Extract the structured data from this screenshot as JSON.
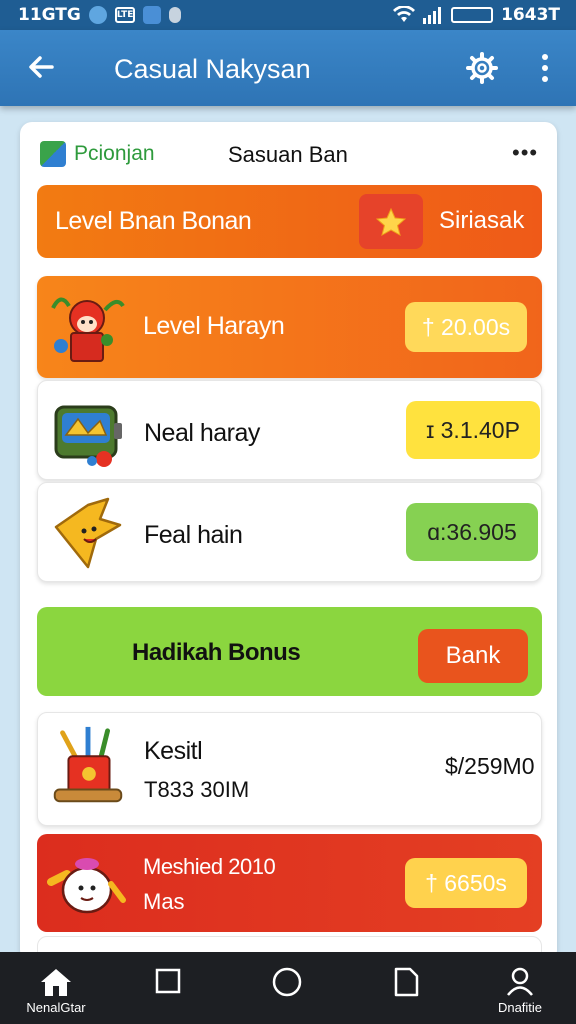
{
  "status": {
    "left_text": "11GTG",
    "box_text": "LTE",
    "right_text": "1643T"
  },
  "appbar": {
    "title": "Casual Nakysan"
  },
  "card": {
    "brand": "Pcionjan",
    "title": "Sasuan Ban",
    "more": "•••"
  },
  "level_banner": {
    "label": "Level Bnan Bonan",
    "side_label": "Siriasak"
  },
  "items": [
    {
      "label": "Level Harayn",
      "value": "† 20.00s"
    },
    {
      "label": "Neal haray",
      "value": "ɪ 3.1.40P"
    },
    {
      "label": "Feal hain",
      "value": "ɑ:36.905"
    }
  ],
  "bonus": {
    "label": "Hadikah Bonus",
    "button": "Bank"
  },
  "kesit": {
    "title": "Kesitl",
    "subtitle": "T833 30IM",
    "amount": "$/259M0"
  },
  "red_item": {
    "title": "Meshied 2010",
    "subtitle": "Mas",
    "value": "† 6650s"
  },
  "nav": {
    "home_label": "NenalGtar",
    "profile_label": "Dnafitie"
  },
  "colors": {
    "appbar": "#2e74b5",
    "orange": "#f27b12",
    "green": "#8bd63f",
    "red": "#dc2d1e",
    "yellow": "#ffe23e"
  }
}
